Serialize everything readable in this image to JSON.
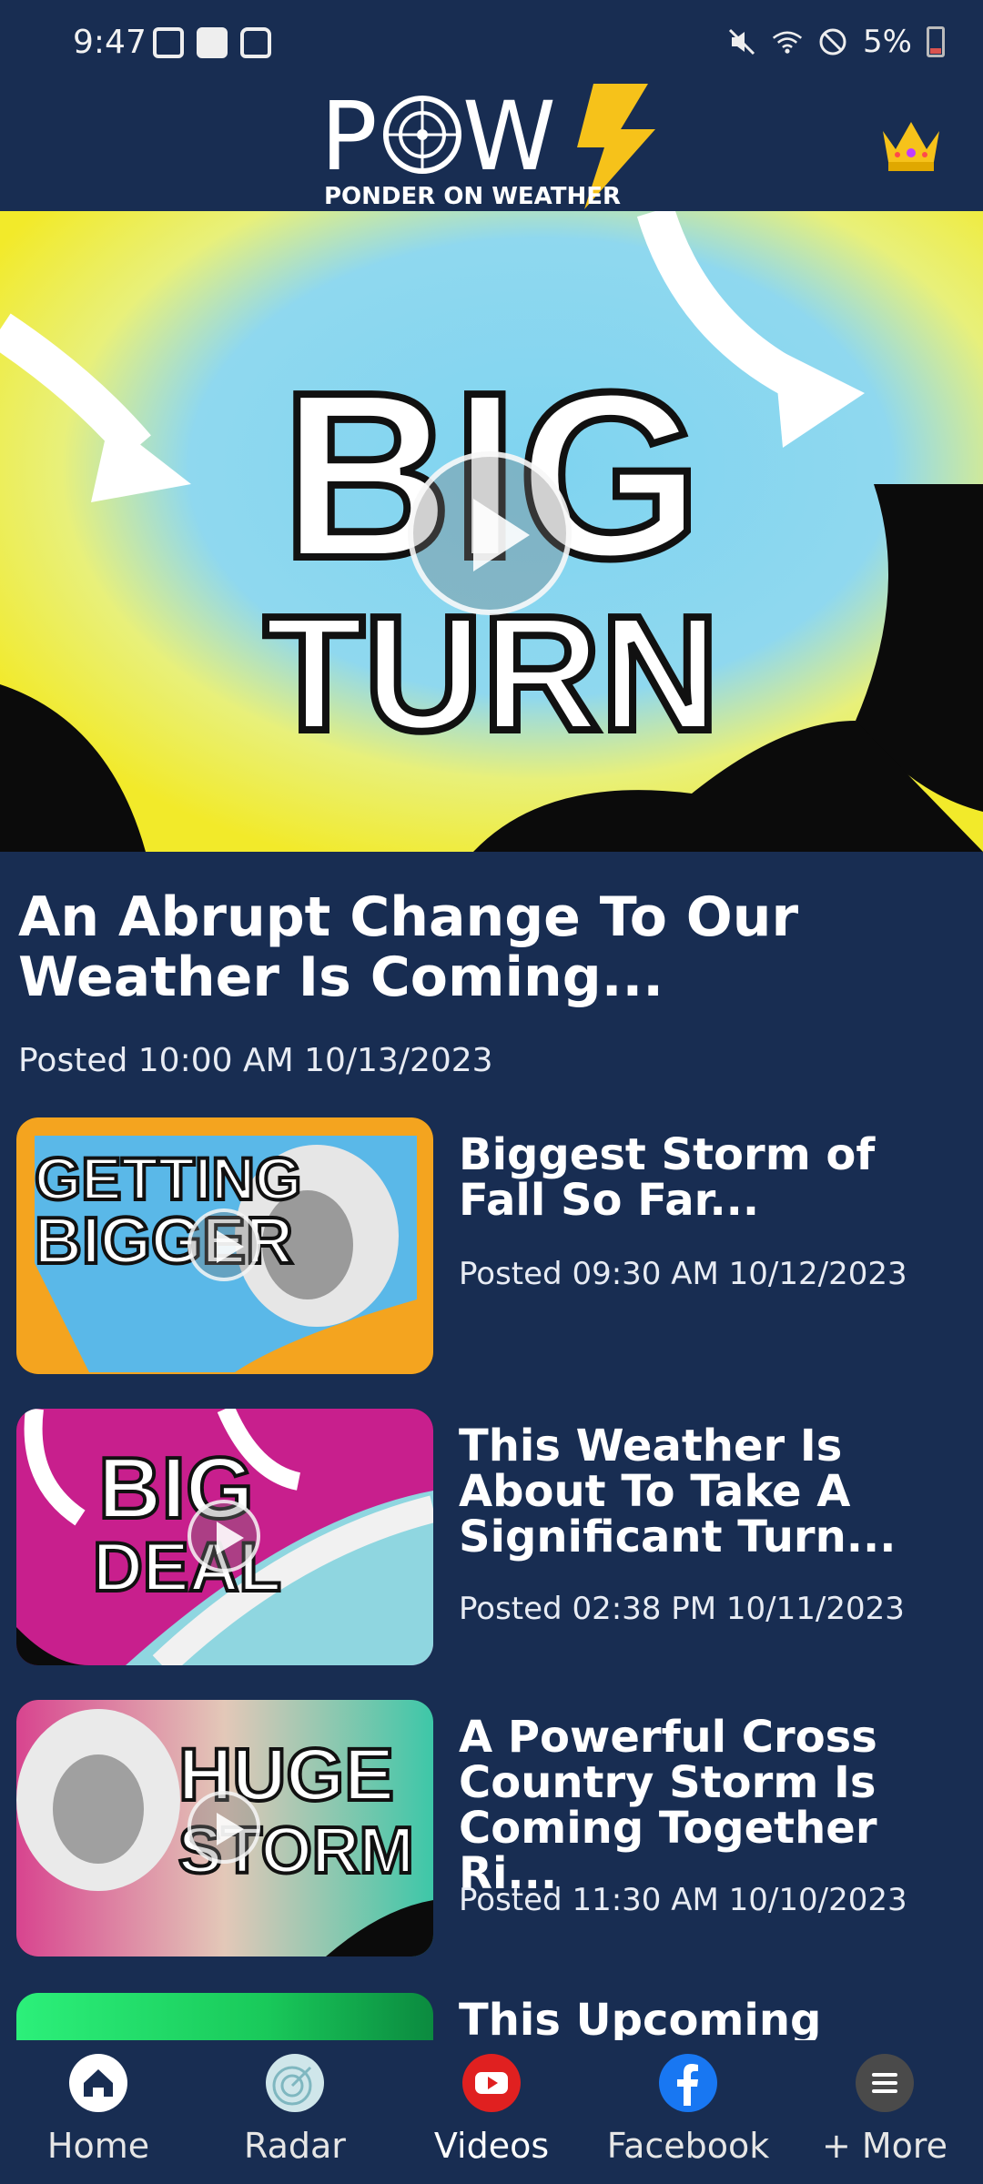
{
  "status_bar": {
    "time": "9:47",
    "battery": "5%"
  },
  "header": {
    "logo_text": "POW",
    "logo_tagline": "PONDER ON WEATHER",
    "premium_icon": "crown-icon"
  },
  "featured": {
    "thumbnail_text_line1": "BIG",
    "thumbnail_text_line2": "TURN",
    "title": "An Abrupt Change To Our Weather Is Coming...",
    "posted": "Posted 10:00 AM 10/13/2023"
  },
  "videos": [
    {
      "thumb_line1": "GETTING",
      "thumb_line2": "BIGGER",
      "title": "Biggest Storm of Fall So Far...",
      "posted": "Posted 09:30 AM 10/12/2023"
    },
    {
      "thumb_line1": "BIG",
      "thumb_line2": "DEAL",
      "title": "This Weather Is About To Take A Significant Turn...",
      "posted": "Posted 02:38 PM 10/11/2023"
    },
    {
      "thumb_line1": "HUGE",
      "thumb_line2": "STORM",
      "title": "A Powerful Cross Country Storm Is Coming Together Ri...",
      "posted": "Posted 11:30 AM 10/10/2023"
    },
    {
      "title": "This Upcoming"
    }
  ],
  "bottom_nav": {
    "items": [
      {
        "label": "Home",
        "icon": "home-icon",
        "color": "#ffffff"
      },
      {
        "label": "Radar",
        "icon": "radar-icon",
        "color": "#cfe6ea"
      },
      {
        "label": "Videos",
        "icon": "youtube-icon",
        "color": "#e02020"
      },
      {
        "label": "Facebook",
        "icon": "facebook-icon",
        "color": "#1877f2"
      },
      {
        "label": "+ More",
        "icon": "menu-icon",
        "color": "#4a4a4a"
      }
    ]
  },
  "colors": {
    "background": "#182d52",
    "accent_bolt": "#f6c21a"
  }
}
